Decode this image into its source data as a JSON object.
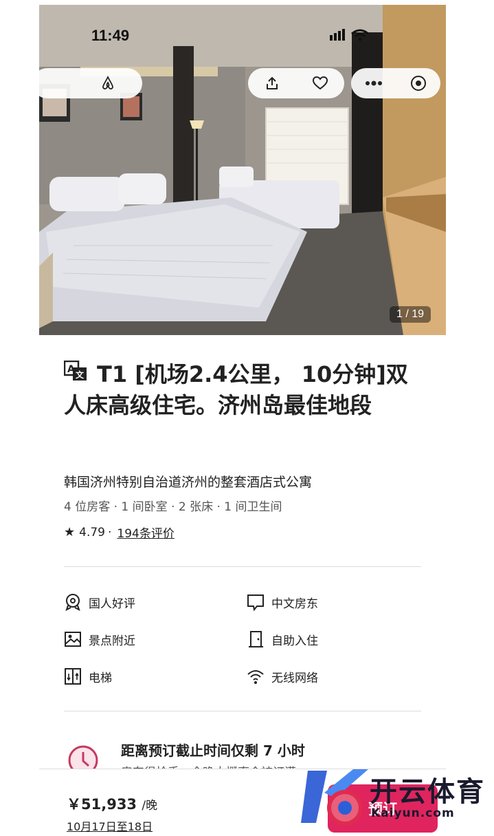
{
  "status_bar": {
    "time": "11:49"
  },
  "photo": {
    "counter": "1 / 19"
  },
  "listing": {
    "title": "T1 [机场2.4公里， 10分钟]双人床高级住宅。济州岛最佳地段",
    "subtitle": "韩国济州特别自治道济州的整套酒店式公寓",
    "details": "4 位房客 · 1 间卧室 · 2 张床 · 1 间卫生间",
    "rating": "4.79",
    "separator": "·",
    "reviews_link": "194条评价"
  },
  "amenities": [
    {
      "icon": "globe-badge-icon",
      "label": "国人好评"
    },
    {
      "icon": "chat-bubble-icon",
      "label": "中文房东"
    },
    {
      "icon": "landscape-image-icon",
      "label": "景点附近"
    },
    {
      "icon": "door-icon",
      "label": "自助入住"
    },
    {
      "icon": "elevator-icon",
      "label": "电梯"
    },
    {
      "icon": "wifi-icon",
      "label": "无线网络"
    }
  ],
  "notice": {
    "title": "距离预订截止时间仅剩 7 小时",
    "subtitle": "房东很抢手，今晚大概率会被订满"
  },
  "footer": {
    "price": "￥51,933",
    "price_unit": "/晚",
    "dates": "10月17日至18日",
    "reserve_label": "预订"
  },
  "watermark": {
    "name_cn": "开云体育",
    "name_en": "Kaiyun.com"
  },
  "colors": {
    "accent": "#e0245e",
    "text": "#222222",
    "muted": "#555555"
  }
}
